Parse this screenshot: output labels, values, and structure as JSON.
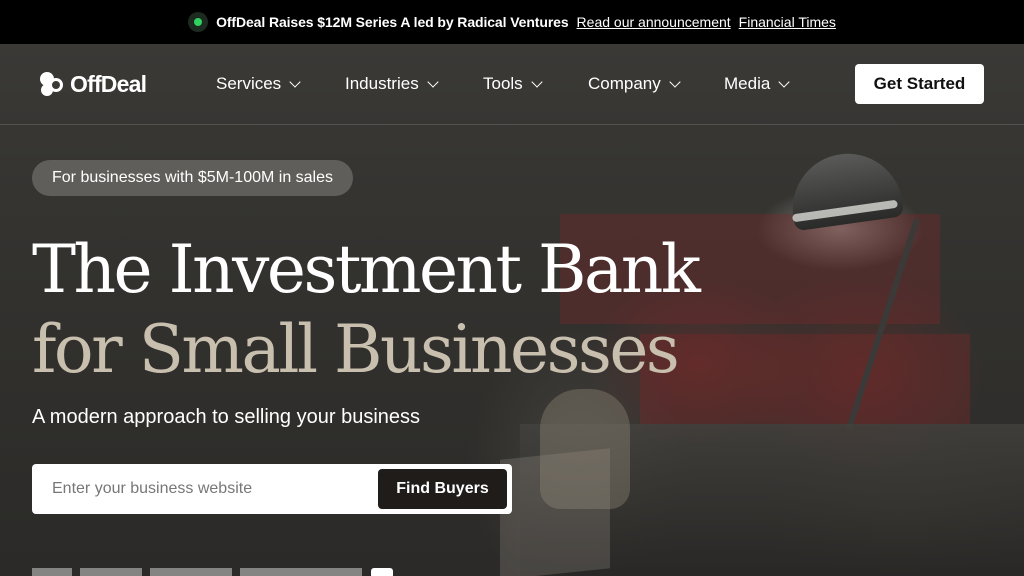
{
  "announcement": {
    "headline": "OffDeal Raises $12M Series A led by Radical Ventures",
    "link_primary": "Read our announcement",
    "link_secondary": "Financial Times",
    "status_color": "#2fd160"
  },
  "nav": {
    "brand": "OffDeal",
    "items": [
      {
        "label": "Services"
      },
      {
        "label": "Industries"
      },
      {
        "label": "Tools"
      },
      {
        "label": "Company"
      },
      {
        "label": "Media"
      }
    ],
    "cta_label": "Get Started"
  },
  "hero": {
    "pill": "For businesses with $5M-100M in sales",
    "title_line1": "The Investment Bank",
    "title_line2": "for Small Businesses",
    "subtitle": "A modern approach to selling your business",
    "input_placeholder": "Enter your business website",
    "input_value": "",
    "button_label": "Find Buyers"
  },
  "colors": {
    "accent_title": "#c8bfae",
    "background": "#2f2e2c",
    "button_dark": "#1f1c1a"
  }
}
